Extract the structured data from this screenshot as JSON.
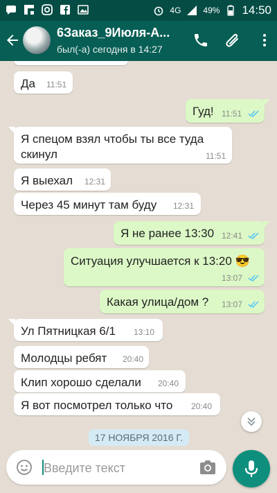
{
  "status_bar": {
    "network": "4G",
    "battery": "49%",
    "time": "14:50"
  },
  "header": {
    "title": "6Заказ_9Июля-А...",
    "subtitle": "был(-а) сегодня в 14:27"
  },
  "messages": [
    {
      "id": "m1",
      "dir": "in",
      "text": "Да",
      "time": "11:51"
    },
    {
      "id": "m2",
      "dir": "out",
      "text": "Гуд!",
      "time": "11:51"
    },
    {
      "id": "m3",
      "dir": "in",
      "text": "Я спецом взял чтобы ты все туда",
      "text2": "скинул",
      "time": "11:51"
    },
    {
      "id": "m4",
      "dir": "in",
      "text": "Я выехал",
      "time": "12:31"
    },
    {
      "id": "m5",
      "dir": "in",
      "text": "Через 45 минут там буду",
      "time": "12:31"
    },
    {
      "id": "m6",
      "dir": "out",
      "text": "Я не ранее 13:30",
      "time": "12:41"
    },
    {
      "id": "m7",
      "dir": "out",
      "text": "Ситуация улучшается к 13:20",
      "emoji": "😎",
      "time": "13:07"
    },
    {
      "id": "m8",
      "dir": "out",
      "text": "Какая улица/дом ?",
      "time": "13:07"
    },
    {
      "id": "m9",
      "dir": "in",
      "text": "Ул Пятницкая 6/1",
      "time": "13:10"
    },
    {
      "id": "m10",
      "dir": "in",
      "text": "Молодцы ребят",
      "time": "20:40"
    },
    {
      "id": "m11",
      "dir": "in",
      "text": "Клип хорошо сделали",
      "time": "20:40"
    },
    {
      "id": "m12",
      "dir": "in",
      "text": "Я вот посмотрел только что",
      "time": "20:40"
    }
  ],
  "date_chip": "17 НОЯБРЯ 2016 Г.",
  "composer": {
    "placeholder": "Введите текст"
  },
  "colors": {
    "header": "#075e54",
    "status_bar": "#054d44",
    "outgoing_bubble": "#dcf8c6",
    "read_ticks": "#4fc3f7",
    "mic_button": "#0e8f7e"
  },
  "icons": {
    "back": "arrow-left-icon",
    "call": "phone-icon",
    "attach": "paperclip-icon",
    "menu": "more-vert-icon",
    "emoji": "smiley-icon",
    "camera": "camera-icon",
    "mic": "microphone-icon",
    "scroll": "chevron-down-double-icon"
  }
}
